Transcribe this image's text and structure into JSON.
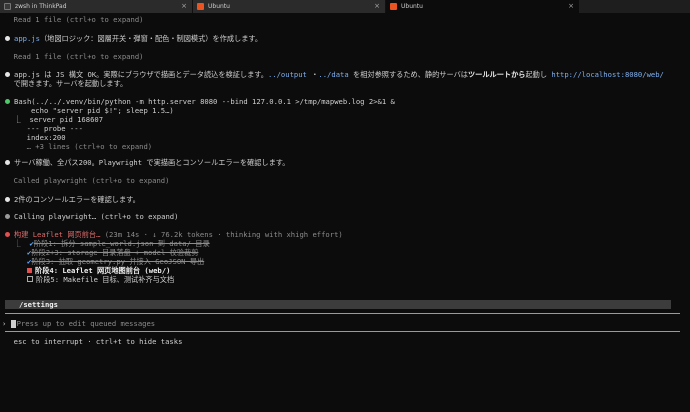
{
  "tabs": [
    {
      "label": "zwsh in ThinkPad",
      "icon": "terminal-icon",
      "active": false
    },
    {
      "label": "Ubuntu",
      "icon": "ubuntu-icon",
      "active": false
    },
    {
      "label": "Ubuntu",
      "icon": "ubuntu-icon",
      "active": true
    }
  ],
  "tab_close": "×",
  "log": {
    "read1": "  Read 1 file (ctrl+o to expand)",
    "appjs_file": "app.js",
    "appjs_desc": "（地図ロジック：図層开关・弾窗・配色・制図模式）を作成します。",
    "read2": "  Read 1 file (ctrl+o to expand)",
    "syntax_a": "app.js は JS 構文 OK。実際にブラウザで描画とデータ読込を検証します。",
    "syntax_path1": "../output",
    "syntax_mid": " ・",
    "syntax_path2": "../data",
    "syntax_b": " を相対参照するため、静的サーバは",
    "syntax_bold": "ツールルートから",
    "syntax_c": "起動し ",
    "syntax_url": "http://localhost:8080/web/",
    "syntax_cont": "  で開きます。サーバを起動します。",
    "bash_cmd": "Bash(../../.venv/bin/python -m http.server 8080 --bind 127.0.0.1 >/tmp/mapweb.log 2>&1 &",
    "bash_cmd2": "      echo \"server pid $!\"; sleep 1.5…)",
    "bash_out1": "  ⎿  server pid 168607",
    "bash_out2": "     --- probe ---",
    "bash_out3": "     index:200",
    "bash_out4": "     … +3 lines (ctrl+o to expand)",
    "server_ok": "サーバ稼働、全パス200。Playwright で実描画とコンソールエラーを確認します。",
    "called_pw": "  Called playwright (ctrl+o to expand)",
    "console_err": "2件のコンソールエラーを確認します。",
    "calling_pw": "Calling playwright… (ctrl+o to expand)",
    "building": "构建 Leaflet 网页前台…",
    "building_meta": " (23m 14s · ↓ 76.2k tokens · thinking with xhigh effort)"
  },
  "tasks": [
    {
      "label": "阶段1: 拆分 sample_world.json 到 data/ 目录",
      "status": "done"
    },
    {
      "label": "阶段2+3: storage 目录落盘 + model 校验裁剪",
      "status": "done"
    },
    {
      "label": "阶段3: 抽取 geometry.py 并接入 GeoJSON 导出",
      "status": "done"
    },
    {
      "label": "阶段4: Leaflet 网页地图前台 (web/)",
      "status": "in_progress"
    },
    {
      "label": "阶段5: Makefile 目标、测试补齐与文档",
      "status": "pending"
    }
  ],
  "task_prefix": "  ⎿  ",
  "settings_label": "/settings",
  "prompt": {
    "symbol": "›",
    "placeholder": "Press up to edit queued messages"
  },
  "footer": "  esc to interrupt · ctrl+t to hide tasks",
  "colors": {
    "accent_red": "#e05050",
    "link": "#7fb0f0",
    "check": "#5fa8ff",
    "ubuntu": "#e95420"
  }
}
